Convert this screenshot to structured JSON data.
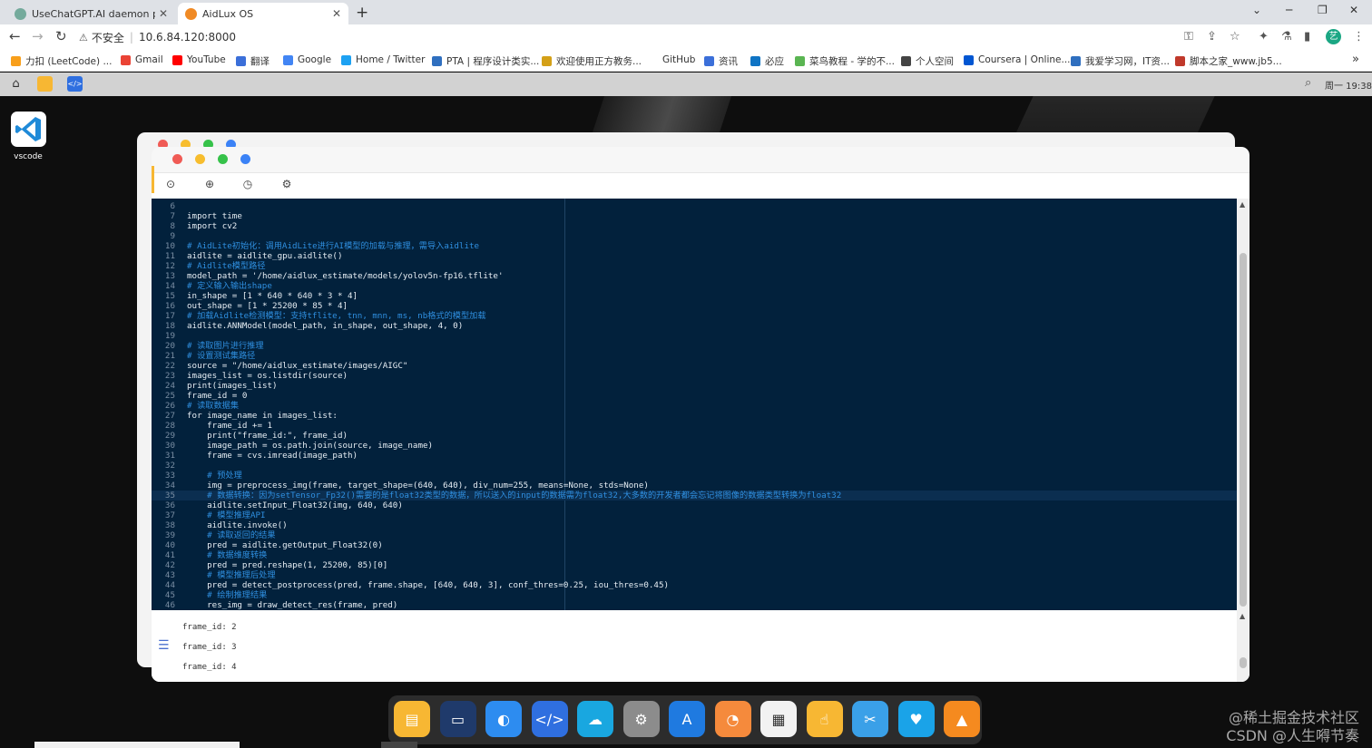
{
  "browser": {
    "tabs": [
      {
        "title": "UseChatGPT.AI daemon proce",
        "favicon_color": "#74aa9c",
        "active": false
      },
      {
        "title": "AidLux OS",
        "favicon_color": "#f08a24",
        "active": true
      }
    ],
    "new_tab": "+",
    "window_controls": [
      "⌄",
      "─",
      "❐",
      "✕"
    ],
    "address": {
      "security_label": "不安全",
      "url": "10.6.84.120:8000"
    },
    "bookmarks": [
      {
        "label": "力扣 (LeetCode) ...",
        "color": "#f89f1b"
      },
      {
        "label": "Gmail",
        "color": "#ea4335"
      },
      {
        "label": "YouTube",
        "color": "#ff0000"
      },
      {
        "label": "翻译",
        "color": "#3b6fd9"
      },
      {
        "label": "Google",
        "color": "#4285f4"
      },
      {
        "label": "Home / Twitter",
        "color": "#1da1f2"
      },
      {
        "label": "PTA | 程序设计类实...",
        "color": "#2f6fbf"
      },
      {
        "label": "欢迎使用正方教务...",
        "color": "#d4a017"
      },
      {
        "label": "GitHub",
        "color": "#ffffff"
      },
      {
        "label": "资讯",
        "color": "#3b6fd9"
      },
      {
        "label": "必应",
        "color": "#0f74c4"
      },
      {
        "label": "菜鸟教程 - 学的不...",
        "color": "#5ab552"
      },
      {
        "label": "个人空间",
        "color": "#444444"
      },
      {
        "label": "Coursera | Online...",
        "color": "#0056d2"
      },
      {
        "label": "我爱学习网，IT资...",
        "color": "#2f6fbf"
      },
      {
        "label": "脚本之家_www.jb5...",
        "color": "#c0392b"
      }
    ],
    "more": "»",
    "profile_initial": "艺"
  },
  "aidlux_bar": {
    "clock": "周一 19:38"
  },
  "desktop": {
    "icons": [
      {
        "label": "vscode"
      }
    ]
  },
  "editor": {
    "lines": [
      {
        "n": "6",
        "code": ""
      },
      {
        "n": "7",
        "code": "import time"
      },
      {
        "n": "8",
        "code": "import cv2"
      },
      {
        "n": "9",
        "code": ""
      },
      {
        "n": "10",
        "code": "# AidLite初始化：调用AidLite进行AI模型的加载与推理，需导入aidlite"
      },
      {
        "n": "11",
        "code": "aidlite = aidlite_gpu.aidlite()"
      },
      {
        "n": "12",
        "code": "# Aidlite模型路径"
      },
      {
        "n": "13",
        "code": "model_path = '/home/aidlux_estimate/models/yolov5n-fp16.tflite'"
      },
      {
        "n": "14",
        "code": "# 定义输入输出shape"
      },
      {
        "n": "15",
        "code": "in_shape = [1 * 640 * 640 * 3 * 4]"
      },
      {
        "n": "16",
        "code": "out_shape = [1 * 25200 * 85 * 4]"
      },
      {
        "n": "17",
        "code": "# 加载Aidlite检测模型：支持tflite, tnn, mnn, ms, nb格式的模型加载"
      },
      {
        "n": "18",
        "code": "aidlite.ANNModel(model_path, in_shape, out_shape, 4, 0)"
      },
      {
        "n": "19",
        "code": ""
      },
      {
        "n": "20",
        "code": "# 读取图片进行推理"
      },
      {
        "n": "21",
        "code": "# 设置测试集路径"
      },
      {
        "n": "22",
        "code": "source = \"/home/aidlux_estimate/images/AIGC\""
      },
      {
        "n": "23",
        "code": "images_list = os.listdir(source)"
      },
      {
        "n": "24",
        "code": "print(images_list)"
      },
      {
        "n": "25",
        "code": "frame_id = 0"
      },
      {
        "n": "26",
        "code": "# 读取数据集"
      },
      {
        "n": "27",
        "code": "for image_name in images_list:"
      },
      {
        "n": "28",
        "code": "    frame_id += 1"
      },
      {
        "n": "29",
        "code": "    print(\"frame_id:\", frame_id)"
      },
      {
        "n": "30",
        "code": "    image_path = os.path.join(source, image_name)"
      },
      {
        "n": "31",
        "code": "    frame = cvs.imread(image_path)"
      },
      {
        "n": "32",
        "code": ""
      },
      {
        "n": "33",
        "code": "    # 预处理"
      },
      {
        "n": "34",
        "code": "    img = preprocess_img(frame, target_shape=(640, 640), div_num=255, means=None, stds=None)"
      },
      {
        "n": "35",
        "code": "    # 数据转换：因为setTensor_Fp32()需要的是float32类型的数据，所以送入的input的数据需为float32,大多数的开发者都会忘记将图像的数据类型转换为float32"
      },
      {
        "n": "36",
        "code": "    aidlite.setInput_Float32(img, 640, 640)"
      },
      {
        "n": "37",
        "code": "    # 模型推理API"
      },
      {
        "n": "38",
        "code": "    aidlite.invoke()"
      },
      {
        "n": "39",
        "code": "    # 读取返回的结果"
      },
      {
        "n": "40",
        "code": "    pred = aidlite.getOutput_Float32(0)"
      },
      {
        "n": "41",
        "code": "    # 数据维度转换"
      },
      {
        "n": "42",
        "code": "    pred = pred.reshape(1, 25200, 85)[0]"
      },
      {
        "n": "43",
        "code": "    # 模型推理后处理"
      },
      {
        "n": "44",
        "code": "    pred = detect_postprocess(pred, frame.shape, [640, 640, 3], conf_thres=0.25, iou_thres=0.45)"
      },
      {
        "n": "45",
        "code": "    # 绘制推理结果"
      },
      {
        "n": "46",
        "code": "    res_img = draw_detect_res(frame, pred)"
      }
    ],
    "current_line": "35"
  },
  "console": {
    "lines": [
      "frame_id: 2",
      "frame_id: 3",
      "frame_id: 4"
    ]
  },
  "dock": {
    "apps": [
      {
        "name": "files",
        "glyph": "▤",
        "color": "#f7b733"
      },
      {
        "name": "terminal",
        "glyph": "▭",
        "color": "#1f3a6b"
      },
      {
        "name": "browser",
        "glyph": "◐",
        "color": "#2d8cf0"
      },
      {
        "name": "code",
        "glyph": "</>",
        "color": "#2f6fe0"
      },
      {
        "name": "cloud",
        "glyph": "☁",
        "color": "#19a7e0"
      },
      {
        "name": "settings",
        "glyph": "⚙",
        "color": "#8c8c8c"
      },
      {
        "name": "app-store",
        "glyph": "A",
        "color": "#1f7ae0"
      },
      {
        "name": "bulb",
        "glyph": "◔",
        "color": "#f58a3c"
      },
      {
        "name": "calculator",
        "glyph": "▦",
        "color": "#f2f2f2"
      },
      {
        "name": "touch",
        "glyph": "☝",
        "color": "#f7b733"
      },
      {
        "name": "tools",
        "glyph": "✂",
        "color": "#3aa0e8"
      },
      {
        "name": "heart",
        "glyph": "♥",
        "color": "#1aa3e8"
      },
      {
        "name": "aidlux",
        "glyph": "▲",
        "color": "#f58a1f"
      }
    ]
  },
  "watermark": {
    "line1": "@稀土掘金技术社区",
    "line2": "CSDN @人生嘚节奏"
  }
}
